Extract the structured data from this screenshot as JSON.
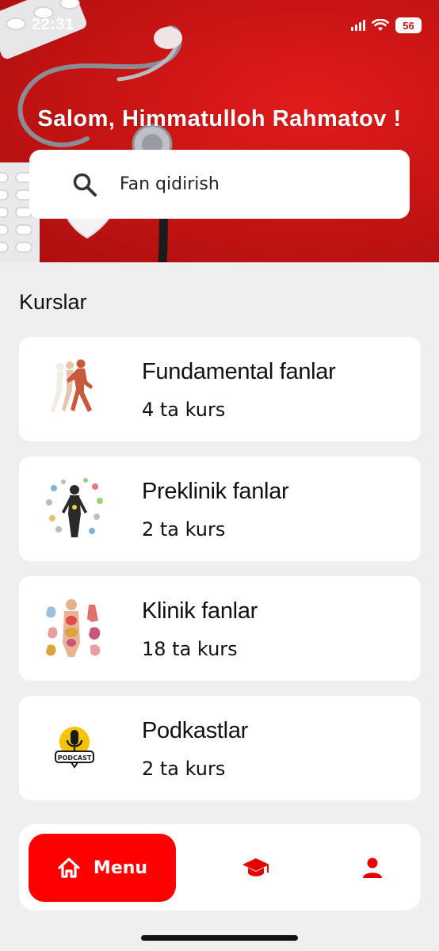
{
  "status_bar": {
    "time": "22:31",
    "battery": "56"
  },
  "header": {
    "greeting": "Salom, Himmatulloh Rahmatov !"
  },
  "search": {
    "placeholder": "Fan qidirish"
  },
  "section": {
    "title": "Kurslar"
  },
  "courses": [
    {
      "title": "Fundamental fanlar",
      "count": "4 ta kurs"
    },
    {
      "title": "Preklinik fanlar",
      "count": "2 ta kurs"
    },
    {
      "title": "Klinik fanlar",
      "count": "18 ta kurs"
    },
    {
      "title": "Podkastlar",
      "count": "2 ta kurs"
    }
  ],
  "podcast_logo_text": "PODCAST",
  "bottom_nav": {
    "menu_label": "Menu"
  },
  "colors": {
    "accent": "#ff0000",
    "hero": "#c91414",
    "background": "#efefef",
    "card": "#ffffff"
  },
  "icons": {
    "search": "search-icon",
    "home": "home-icon",
    "courses": "graduation-cap-icon",
    "profile": "user-icon"
  }
}
